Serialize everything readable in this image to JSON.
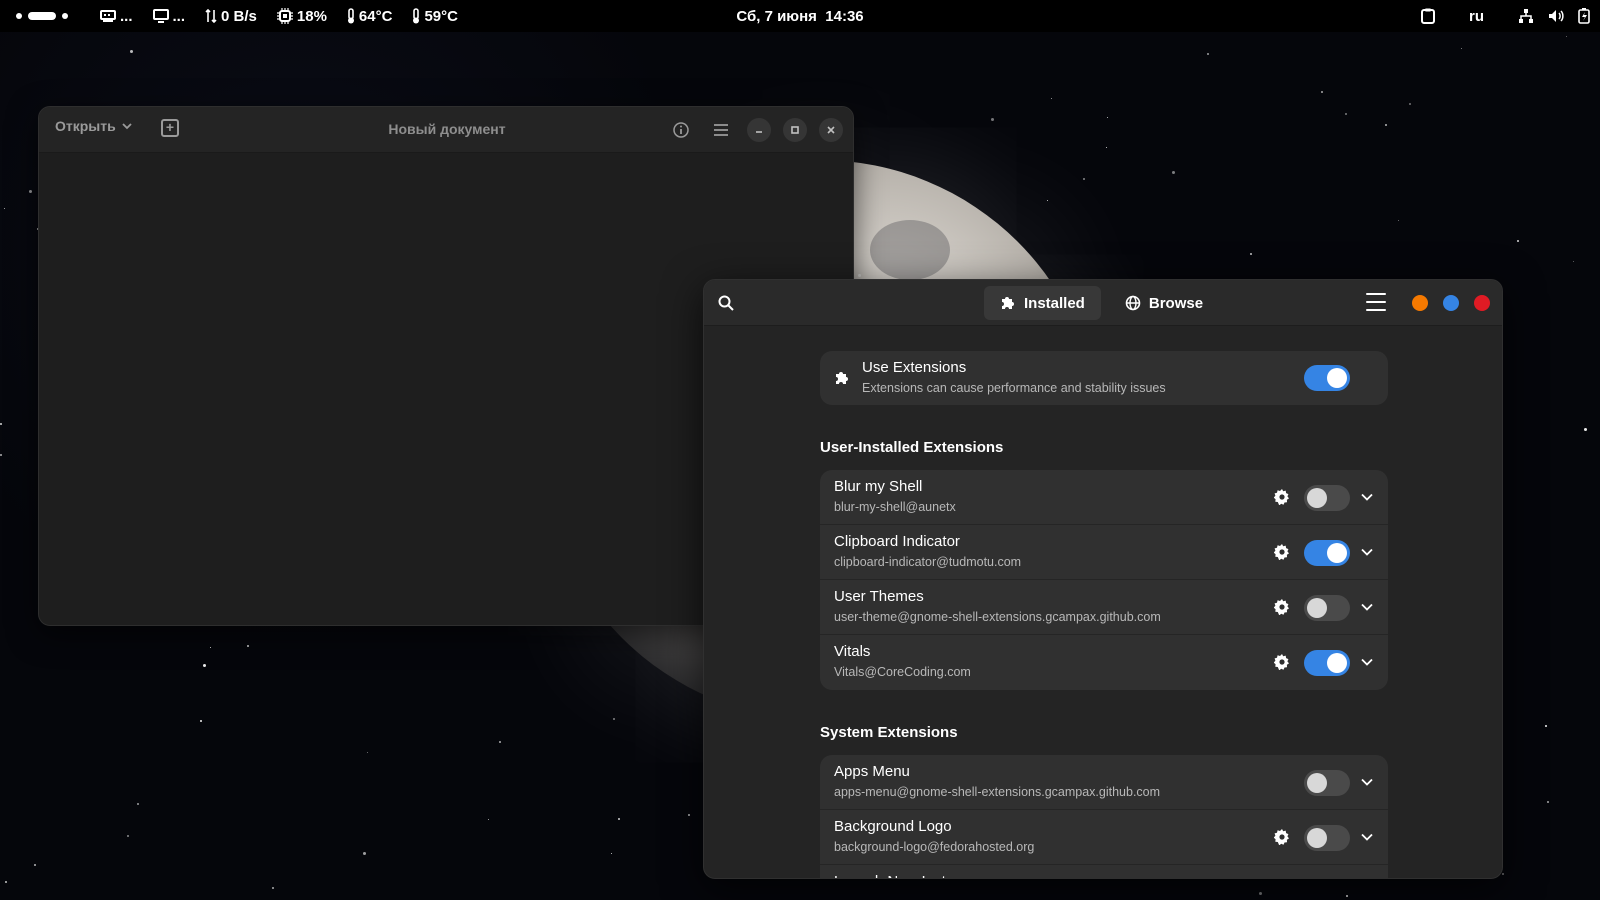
{
  "topbar": {
    "vitals": {
      "network": "0 B/s",
      "cpu": "18%",
      "temp1": "64°C",
      "temp2": "59°C",
      "ellipsis1": "...",
      "ellipsis2": "..."
    },
    "clock": "Сб, 7 июня  14:36",
    "language": "ru"
  },
  "editor": {
    "open_label": "Открыть",
    "title": "Новый документ"
  },
  "extensions": {
    "tabs": [
      {
        "label": "Installed",
        "icon": "puzzle-icon",
        "active": true
      },
      {
        "label": "Browse",
        "icon": "globe-icon",
        "active": false
      }
    ],
    "window_dots": {
      "minimize": "#f57900",
      "maximize": "#3584e4",
      "close": "#e01b24"
    },
    "use_extensions": {
      "title": "Use Extensions",
      "subtitle": "Extensions can cause performance and stability issues",
      "enabled": true
    },
    "user_section_title": "User-Installed Extensions",
    "user_extensions": [
      {
        "name": "Blur my Shell",
        "uuid": "blur-my-shell@aunetx",
        "enabled": false,
        "has_settings": true
      },
      {
        "name": "Clipboard Indicator",
        "uuid": "clipboard-indicator@tudmotu.com",
        "enabled": true,
        "has_settings": true
      },
      {
        "name": "User Themes",
        "uuid": "user-theme@gnome-shell-extensions.gcampax.github.com",
        "enabled": false,
        "has_settings": true
      },
      {
        "name": "Vitals",
        "uuid": "Vitals@CoreCoding.com",
        "enabled": true,
        "has_settings": true
      }
    ],
    "system_section_title": "System Extensions",
    "system_extensions": [
      {
        "name": "Apps Menu",
        "uuid": "apps-menu@gnome-shell-extensions.gcampax.github.com",
        "enabled": false,
        "has_settings": false
      },
      {
        "name": "Background Logo",
        "uuid": "background-logo@fedorahosted.org",
        "enabled": false,
        "has_settings": true
      },
      {
        "name": "Launch New Instance",
        "uuid": "",
        "enabled": false,
        "has_settings": false
      }
    ]
  }
}
